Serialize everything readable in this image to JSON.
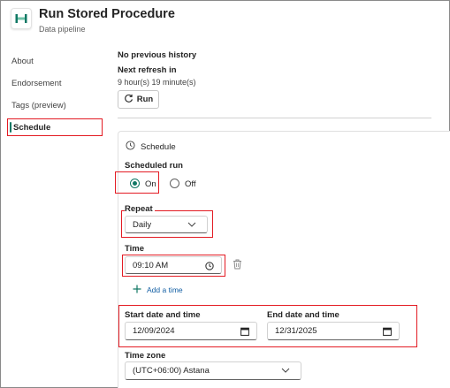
{
  "header": {
    "title": "Run Stored Procedure",
    "subtitle": "Data pipeline",
    "icon": "pipeline-icon"
  },
  "sidebar": {
    "items": [
      {
        "label": "About",
        "active": false
      },
      {
        "label": "Endorsement",
        "active": false
      },
      {
        "label": "Tags (preview)",
        "active": false
      },
      {
        "label": "Schedule",
        "active": true
      }
    ]
  },
  "history": {
    "no_history": "No previous history",
    "next_refresh_label": "Next refresh in",
    "next_refresh_value": "9 hour(s) 19 minute(s)",
    "run_label": "Run"
  },
  "schedule": {
    "section_title": "Schedule",
    "scheduled_run_label": "Scheduled run",
    "on_label": "On",
    "off_label": "Off",
    "scheduled_run_value": "On",
    "repeat_label": "Repeat",
    "repeat_value": "Daily",
    "time_label": "Time",
    "time_value": "09:10 AM",
    "add_time_label": "Add a time",
    "start_label": "Start date and time",
    "start_value": "12/09/2024",
    "end_label": "End date and time",
    "end_value": "12/31/2025",
    "timezone_label": "Time zone",
    "timezone_value": "(UTC+06:00) Astana"
  },
  "colors": {
    "accent": "#117865",
    "highlight": "#e31b23",
    "link": "#115ea3"
  }
}
